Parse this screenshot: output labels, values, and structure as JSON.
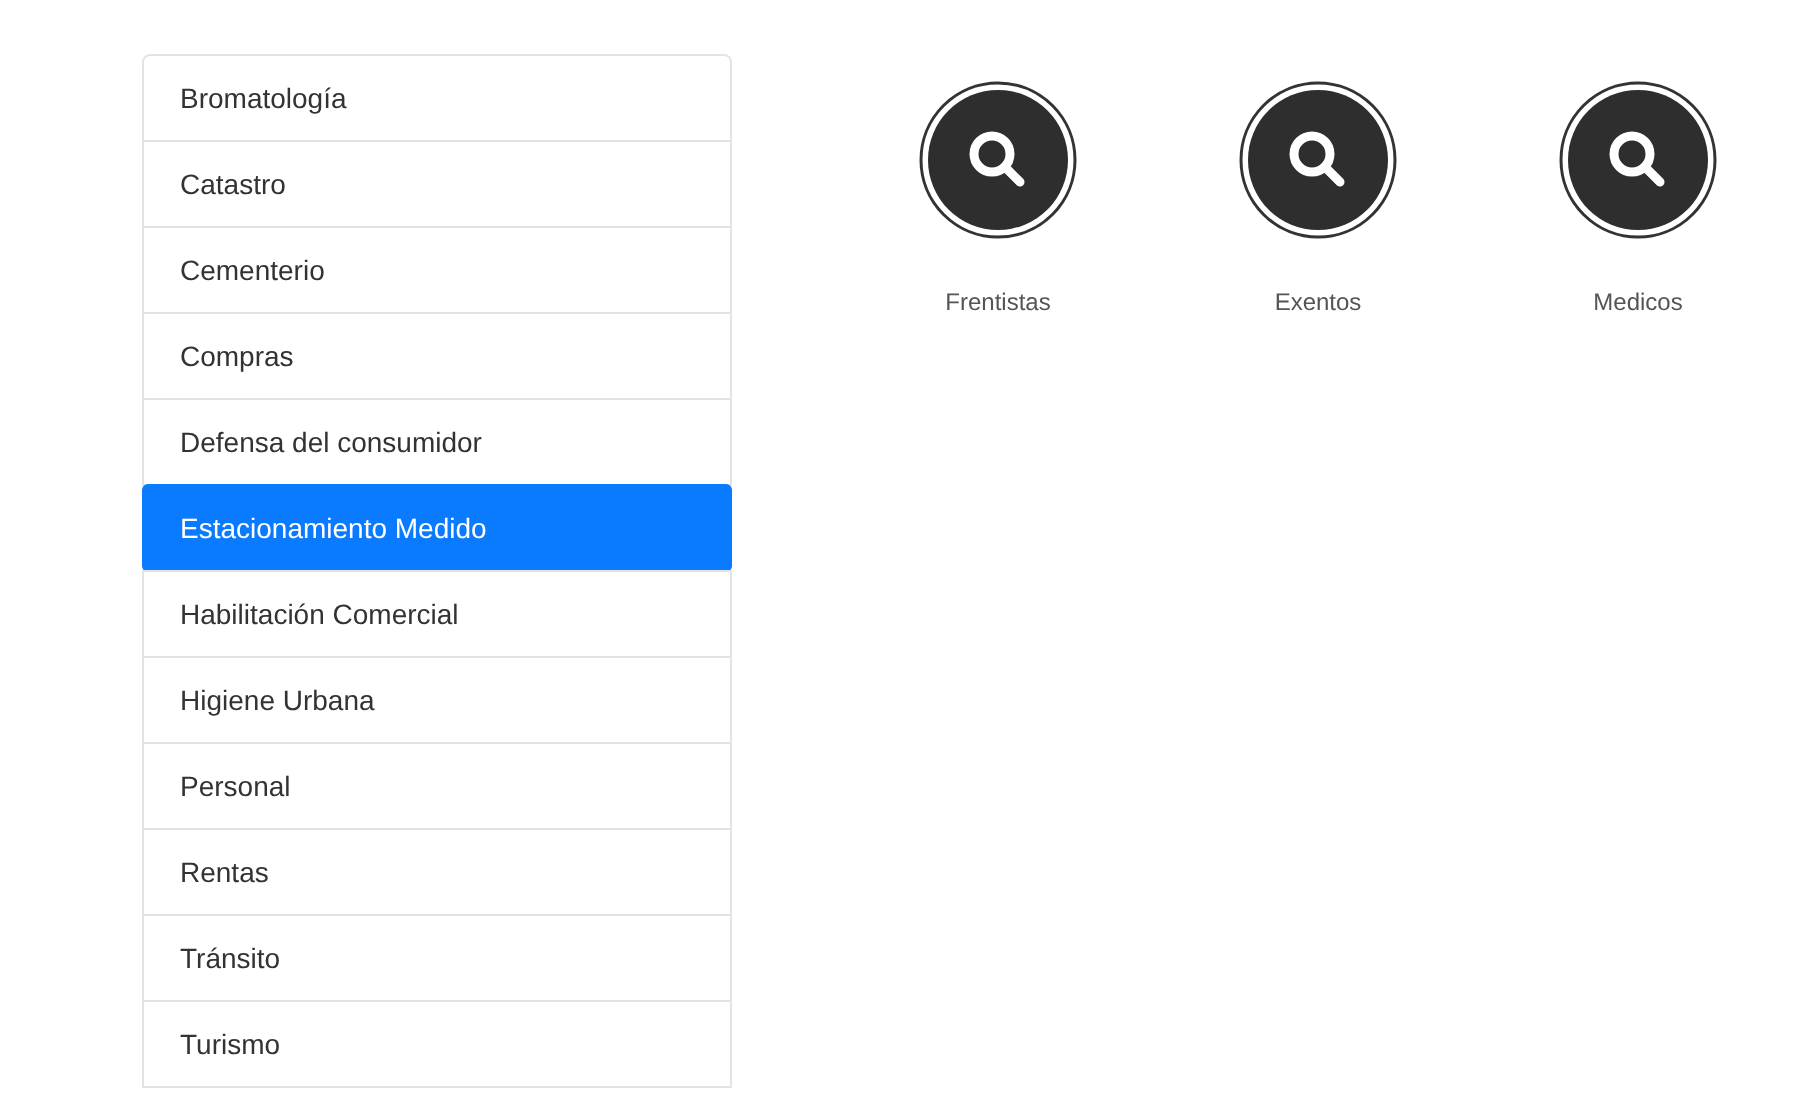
{
  "menu": {
    "items": [
      {
        "label": "Bromatología",
        "selected": false
      },
      {
        "label": "Catastro",
        "selected": false
      },
      {
        "label": "Cementerio",
        "selected": false
      },
      {
        "label": "Compras",
        "selected": false
      },
      {
        "label": "Defensa del consumidor",
        "selected": false
      },
      {
        "label": "Estacionamiento Medido",
        "selected": true
      },
      {
        "label": "Habilitación Comercial",
        "selected": false
      },
      {
        "label": "Higiene Urbana",
        "selected": false
      },
      {
        "label": "Personal",
        "selected": false
      },
      {
        "label": "Rentas",
        "selected": false
      },
      {
        "label": "Tránsito",
        "selected": false
      },
      {
        "label": "Turismo",
        "selected": false
      }
    ]
  },
  "shortcuts": [
    {
      "label": "Frentistas"
    },
    {
      "label": "Exentos"
    },
    {
      "label": "Medicos"
    }
  ]
}
